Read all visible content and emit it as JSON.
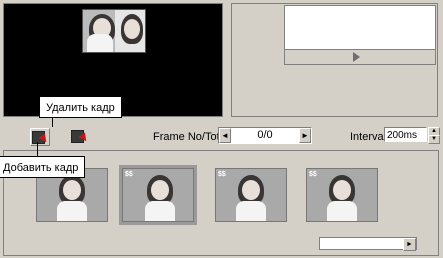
{
  "toolbar": {
    "frame_label": "Frame No/Total",
    "frame_value": "0/0",
    "interval_label": "Interval",
    "interval_value": "200ms"
  },
  "callouts": {
    "delete_frame": "Удалить кадр",
    "add_frame": "Добавить кадр"
  },
  "icons": {
    "add": "add-frame-icon",
    "delete": "delete-frame-icon",
    "play": "play-icon"
  },
  "colors": {
    "video_bg": "#000000",
    "window_bg": "#d4d0c8",
    "arrow_red": "#c0181a"
  }
}
